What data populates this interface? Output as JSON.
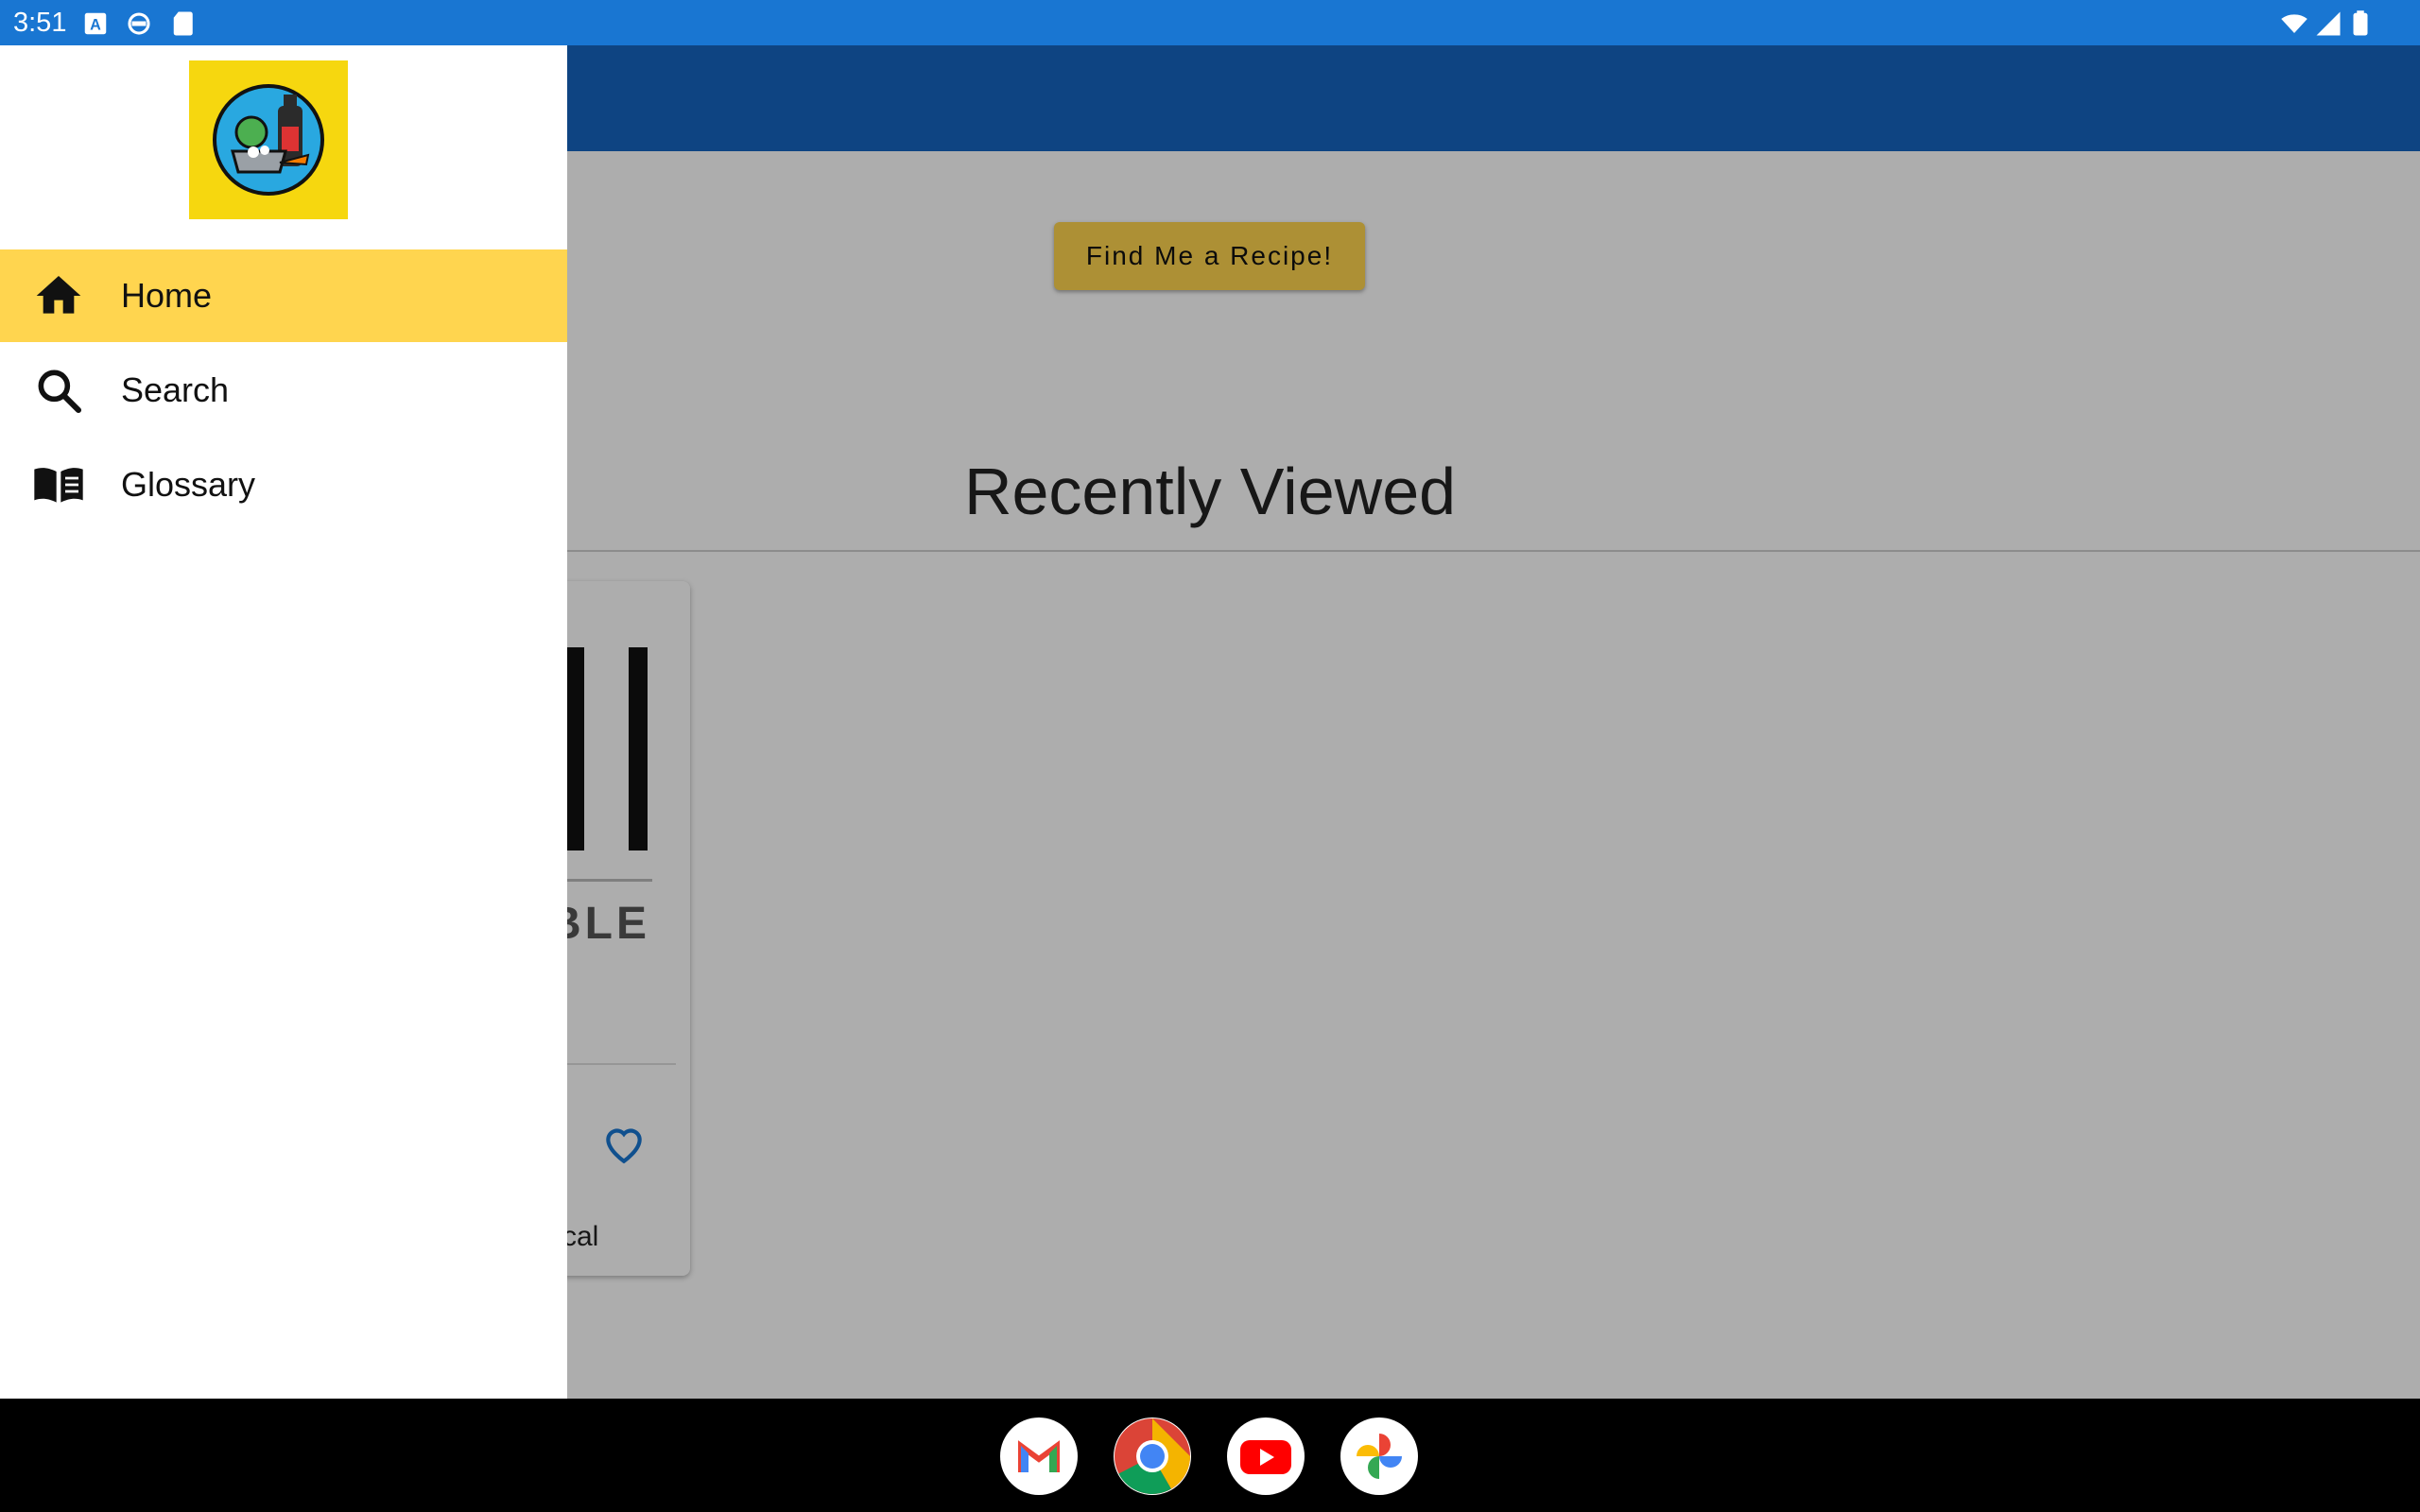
{
  "status_bar": {
    "time": "3:51"
  },
  "main": {
    "find_button_label": "Find Me a Recipe!",
    "recently_viewed_title": "Recently Viewed",
    "recipe_card": {
      "image_text": "BLE",
      "calories_label": "cal"
    }
  },
  "drawer": {
    "items": [
      {
        "label": "Home",
        "icon": "home-icon",
        "active": true
      },
      {
        "label": "Search",
        "icon": "search-icon",
        "active": false
      },
      {
        "label": "Glossary",
        "icon": "book-icon",
        "active": false
      }
    ]
  },
  "dock": {
    "apps": [
      "gmail-icon",
      "chrome-icon",
      "youtube-icon",
      "photos-icon"
    ]
  },
  "colors": {
    "status_bar": "#1976D2",
    "app_bar": "#1565C0",
    "accent": "#FFD54F",
    "logo_bg": "#F6D70F"
  }
}
